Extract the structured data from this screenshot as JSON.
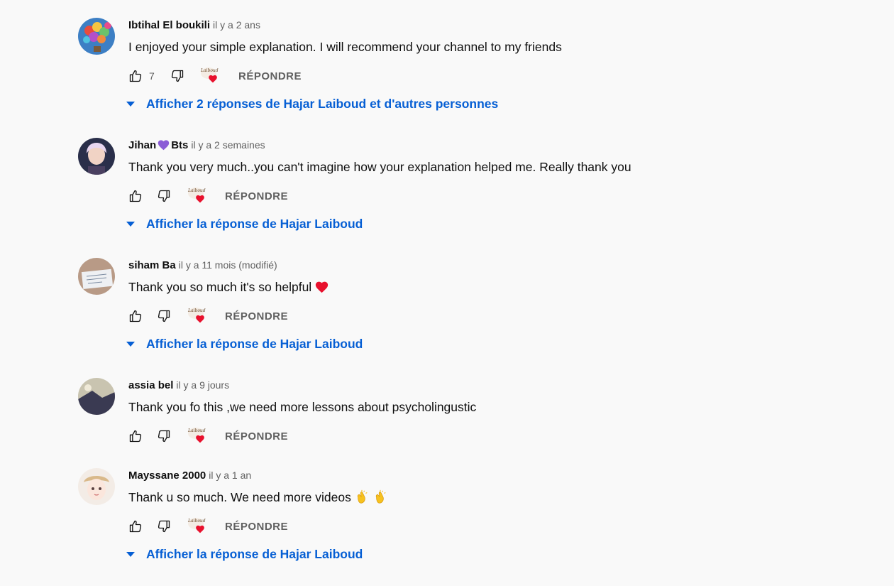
{
  "comments": [
    {
      "author": "Ibtihal El boukili",
      "author_suffix": "",
      "time": "il y a 2 ans",
      "text": "I enjoyed your simple explanation. I will recommend your channel to my friends",
      "likes": "7",
      "reply_label": "RÉPONDRE",
      "replies_link": "Afficher 2 réponses de Hajar Laiboud et d'autres personnes",
      "avatar_icon": "balloons-avatar"
    },
    {
      "author": "Jihan",
      "author_suffix": "Bts",
      "time": "il y a 2 semaines",
      "text": "Thank you very much..you can't imagine how your explanation helped me. Really thank you",
      "likes": "",
      "reply_label": "RÉPONDRE",
      "replies_link": "Afficher la réponse de Hajar Laiboud",
      "avatar_icon": "person-avatar"
    },
    {
      "author": "siham Ba",
      "author_suffix": "",
      "time": "il y a 11 mois (modifié)",
      "text": "Thank you so much it's so helpful",
      "likes": "",
      "reply_label": "RÉPONDRE",
      "replies_link": "Afficher la réponse de Hajar Laiboud",
      "avatar_icon": "note-avatar"
    },
    {
      "author": "assia bel",
      "author_suffix": "",
      "time": "il y a 9 jours",
      "text": "Thank you fo this ,we need more lessons about psycholingustic",
      "likes": "",
      "reply_label": "RÉPONDRE",
      "replies_link": "",
      "avatar_icon": "photo-avatar"
    },
    {
      "author": "Mayssane 2000",
      "author_suffix": "",
      "time": "il y a 1 an",
      "text": "Thank u so much. We need more videos",
      "likes": "",
      "reply_label": "RÉPONDRE",
      "replies_link": "Afficher la réponse de Hajar Laiboud",
      "avatar_icon": "anime-avatar"
    }
  ],
  "creator_heart_text": "Laiboud",
  "colors": {
    "link": "#065fd4",
    "secondary": "#606060",
    "heart": "#e8112d"
  }
}
